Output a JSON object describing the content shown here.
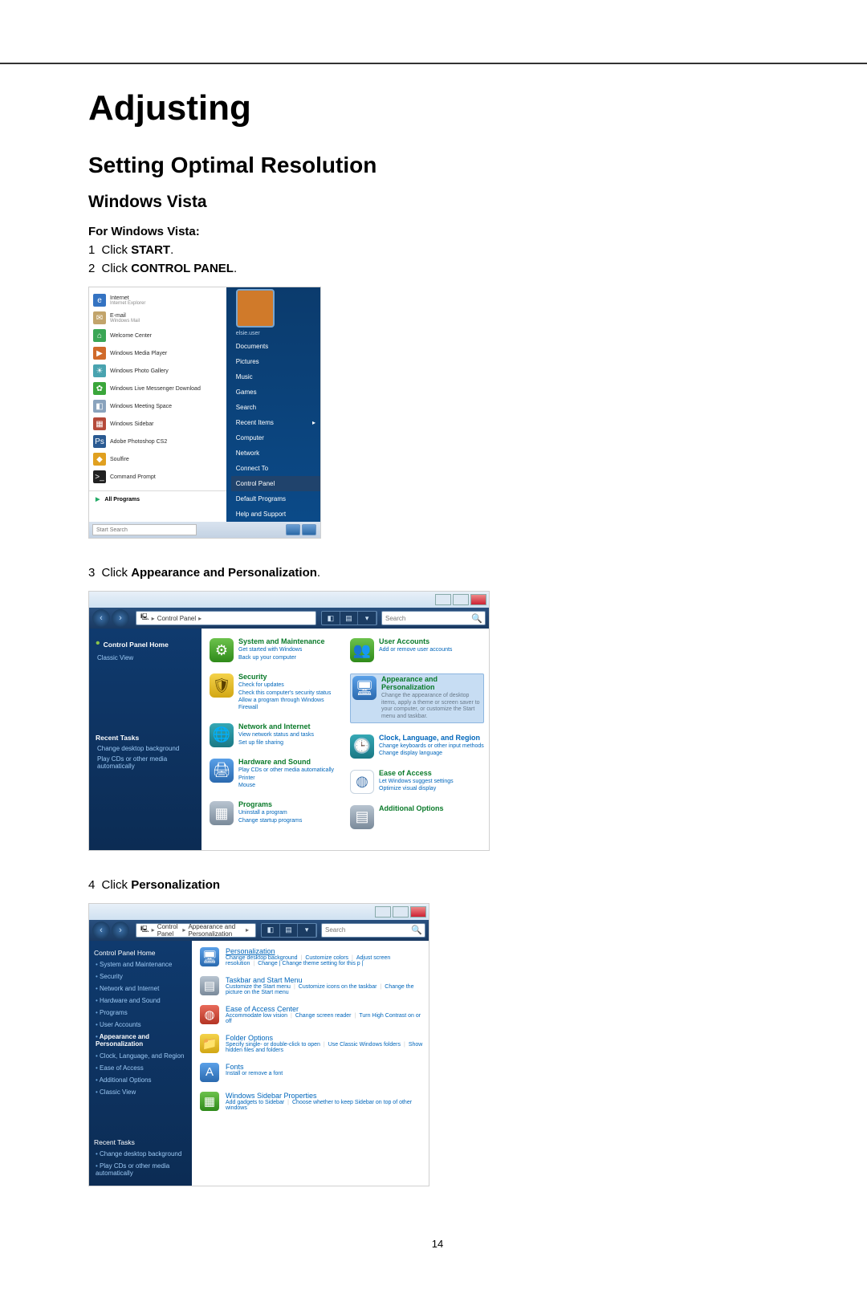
{
  "page_number": "14",
  "heading": "Adjusting",
  "section1": "Setting Optimal Resolution",
  "section2": "Windows Vista",
  "intro_bold": "For Windows Vista:",
  "step1_num": "1",
  "step1_prefix": "Click ",
  "step1_bold": "START",
  "step1_suffix": ".",
  "step2_num": "2",
  "step2_prefix": "Click ",
  "step2_bold": "CONTROL PANEL",
  "step2_suffix": ".",
  "step3_num": "3",
  "step3_prefix": "Click ",
  "step3_bold": "Appearance and Personalization",
  "step3_suffix": ".",
  "step4_num": "4",
  "step4_prefix": "Click ",
  "step4_bold": "Personalization",
  "start_menu": {
    "avatar_alt": "User avatar",
    "items": [
      {
        "title": "Internet",
        "sub": "Internet Explorer"
      },
      {
        "title": "E-mail",
        "sub": "Windows Mail"
      },
      {
        "title": "Welcome Center",
        "sub": ""
      },
      {
        "title": "Windows Media Player",
        "sub": ""
      },
      {
        "title": "Windows Photo Gallery",
        "sub": ""
      },
      {
        "title": "Windows Live Messenger Download",
        "sub": ""
      },
      {
        "title": "Windows Meeting Space",
        "sub": ""
      },
      {
        "title": "Windows Sidebar",
        "sub": ""
      },
      {
        "title": "Adobe Photoshop CS2",
        "sub": ""
      },
      {
        "title": "Soulfire",
        "sub": ""
      },
      {
        "title": "Command Prompt",
        "sub": ""
      }
    ],
    "all_programs": "All Programs",
    "search_placeholder": "Start Search",
    "right": {
      "user": "elsie.user",
      "items": [
        "Documents",
        "Pictures",
        "Music",
        "Games",
        "Search",
        "Recent Items",
        "Computer",
        "Network",
        "Connect To",
        "Control Panel",
        "Default Programs",
        "Help and Support"
      ],
      "highlight_index": 9
    }
  },
  "control_panel": {
    "breadcrumb": [
      "Control Panel"
    ],
    "search_placeholder": "Search",
    "side": {
      "heading": "Control Panel Home",
      "classic_view": "Classic View",
      "recent_heading": "Recent Tasks",
      "recent": [
        "Change desktop background",
        "Play CDs or other media automatically"
      ]
    },
    "categories_left": [
      {
        "title": "System and Maintenance",
        "subs": [
          "Get started with Windows",
          "Back up your computer"
        ]
      },
      {
        "title": "Security",
        "subs": [
          "Check for updates",
          "Check this computer's security status",
          "Allow a program through Windows Firewall"
        ]
      },
      {
        "title": "Network and Internet",
        "subs": [
          "View network status and tasks",
          "Set up file sharing"
        ]
      },
      {
        "title": "Hardware and Sound",
        "subs": [
          "Play CDs or other media automatically",
          "Printer",
          "Mouse"
        ]
      },
      {
        "title": "Programs",
        "subs": [
          "Uninstall a program",
          "Change startup programs"
        ]
      }
    ],
    "categories_right": [
      {
        "title": "User Accounts",
        "subs": [
          "Add or remove user accounts"
        ]
      },
      {
        "title": "Appearance and Personalization",
        "subs": [
          "Change the appearance of desktop items, apply a theme or screen saver to your computer, or customize the Start menu and taskbar."
        ],
        "selected": true
      },
      {
        "title": "Clock, Language, and Region",
        "subs": [
          "Change keyboards or other input methods",
          "Change display language"
        ]
      },
      {
        "title": "Ease of Access",
        "subs": [
          "Let Windows suggest settings",
          "Optimize visual display"
        ]
      },
      {
        "title": "Additional Options",
        "subs": []
      }
    ]
  },
  "appearance_panel": {
    "breadcrumb": [
      "Control Panel",
      "Appearance and Personalization"
    ],
    "search_placeholder": "Search",
    "side": {
      "heading": "Control Panel Home",
      "items": [
        "System and Maintenance",
        "Security",
        "Network and Internet",
        "Hardware and Sound",
        "Programs",
        "User Accounts",
        "Appearance and Personalization",
        "Clock, Language, and Region",
        "Ease of Access",
        "Additional Options"
      ],
      "active_index": 6,
      "classic_view": "Classic View",
      "recent_heading": "Recent Tasks",
      "recent": [
        "Change desktop background",
        "Play CDs or other media automatically"
      ]
    },
    "items": [
      {
        "title": "Personalization",
        "subs": [
          "Change desktop background",
          "Customize colors",
          "Adjust screen resolution",
          "Change | Change theme setting for this p |"
        ]
      },
      {
        "title": "Taskbar and Start Menu",
        "subs": [
          "Customize the Start menu",
          "Customize icons on the taskbar",
          "Change the picture on the Start menu"
        ]
      },
      {
        "title": "Ease of Access Center",
        "subs": [
          "Accommodate low vision",
          "Change screen reader",
          "Turn High Contrast on or off"
        ]
      },
      {
        "title": "Folder Options",
        "subs": [
          "Specify single- or double-click to open",
          "Use Classic Windows folders",
          "Show hidden files and folders"
        ]
      },
      {
        "title": "Fonts",
        "subs": [
          "Install or remove a font"
        ]
      },
      {
        "title": "Windows Sidebar Properties",
        "subs": [
          "Add gadgets to Sidebar",
          "Choose whether to keep Sidebar on top of other windows"
        ]
      }
    ]
  }
}
